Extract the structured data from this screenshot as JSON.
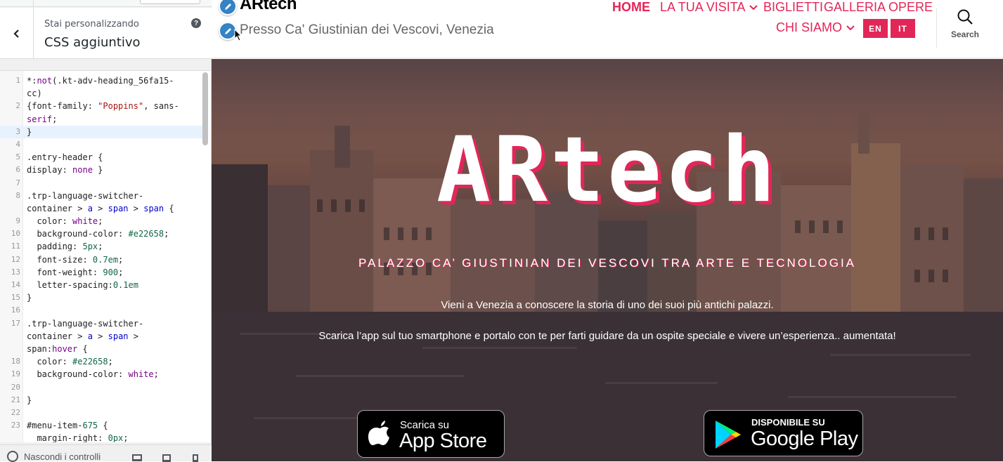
{
  "sidebar": {
    "customizing_label": "Stai personalizzando",
    "section_title": "CSS aggiuntivo",
    "help_icon": "?",
    "footer": {
      "hide_controls_label": "Nascondi i controlli"
    }
  },
  "code_lines": [
    {
      "n": "1",
      "text": "*:not(.kt-adv-heading_56fa15-"
    },
    {
      "n": "",
      "text": "cc)"
    },
    {
      "n": "2",
      "text": "{font-family: \"Poppins\", sans-"
    },
    {
      "n": "",
      "text": "serif;"
    },
    {
      "n": "3",
      "text": "}"
    },
    {
      "n": "4",
      "text": ""
    },
    {
      "n": "5",
      "text": ".entry-header {"
    },
    {
      "n": "6",
      "text": "display: none }"
    },
    {
      "n": "7",
      "text": ""
    },
    {
      "n": "8",
      "text": ".trp-language-switcher-"
    },
    {
      "n": "",
      "text": "container > a > span > span {"
    },
    {
      "n": "9",
      "text": "  color: white;"
    },
    {
      "n": "10",
      "text": "  background-color: #e22658;"
    },
    {
      "n": "11",
      "text": "  padding: 5px;"
    },
    {
      "n": "12",
      "text": "  font-size: 0.7em;"
    },
    {
      "n": "13",
      "text": "  font-weight: 900;"
    },
    {
      "n": "14",
      "text": "  letter-spacing:0.1em"
    },
    {
      "n": "15",
      "text": "}"
    },
    {
      "n": "16",
      "text": ""
    },
    {
      "n": "17",
      "text": ".trp-language-switcher-"
    },
    {
      "n": "",
      "text": "container > a > span >"
    },
    {
      "n": "",
      "text": "span:hover {"
    },
    {
      "n": "18",
      "text": "  color: #e22658;"
    },
    {
      "n": "19",
      "text": "  background-color: white;"
    },
    {
      "n": "20",
      "text": ""
    },
    {
      "n": "21",
      "text": "}"
    },
    {
      "n": "22",
      "text": ""
    },
    {
      "n": "23",
      "text": "#menu-item-675 {"
    },
    {
      "n": "",
      "text": "  margin-right: 0px;"
    }
  ],
  "site": {
    "title": "ARtech",
    "tagline": "Presso Ca' Giustinian dei Vescovi, Venezia",
    "nav": {
      "home": "HOME",
      "visit": "LA TUA VISITA",
      "tickets": "BIGLIETTI",
      "gallery": "GALLERIA OPERE",
      "about": "CHI SIAMO"
    },
    "lang": {
      "en": "EN",
      "it": "IT"
    },
    "search_label": "Search",
    "accent_color": "#e22658"
  },
  "hero": {
    "title": "ARtech",
    "subtitle": "PALAZZO CA’ GIUSTINIAN DEI VESCOVI TRA ARTE E TECNOLOGIA",
    "p1": "Vieni a Venezia a conoscere la storia di uno dei suoi più antichi palazzi.",
    "p2": "Scarica l’app sul tuo smartphone e portalo con te per farti guidare da un ospite speciale e vivere un’esperienza.. aumentata!",
    "appstore": {
      "small": "Scarica su",
      "big": "App Store"
    },
    "googleplay": {
      "small": "DISPONIBILE SU",
      "big": "Google Play"
    }
  }
}
